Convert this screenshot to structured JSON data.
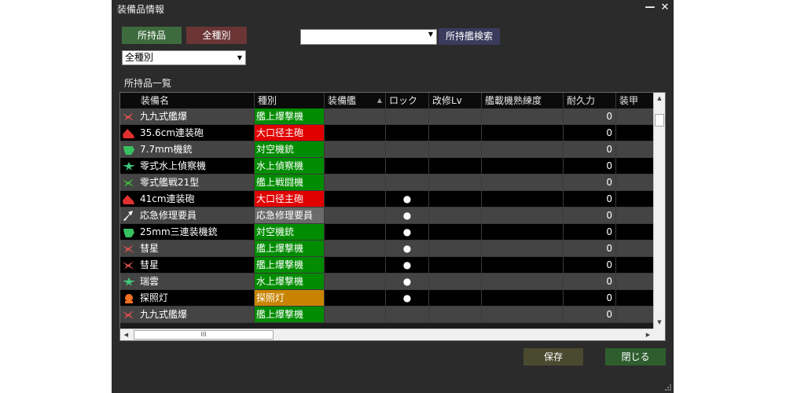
{
  "window": {
    "title": "装備品情報",
    "minimize_glyph": "—",
    "close_glyph": "✕"
  },
  "toolbar": {
    "owned_label": "所持品",
    "all_types_label": "全種別",
    "type_filter_value": "全種別",
    "ship_search_value": "",
    "ship_search_button": "所持艦検索"
  },
  "list_label": "所持品一覧",
  "columns": [
    "装備名",
    "種別",
    "装備艦",
    "ロック",
    "改修Lv",
    "艦載機熟練度",
    "耐久力",
    "装甲"
  ],
  "rows": [
    {
      "name": "九九式艦爆",
      "type": "艦上爆撃機",
      "type_color": "#008c00",
      "icon": "dive-bomber-icon",
      "icon_color": "#e05050",
      "locked": "",
      "durability": "0"
    },
    {
      "name": "35.6cm連装砲",
      "type": "大口径主砲",
      "type_color": "#e00000",
      "icon": "large-gun-icon",
      "icon_color": "#e03030",
      "locked": "",
      "durability": "0"
    },
    {
      "name": "7.7mm機銃",
      "type": "対空機銃",
      "type_color": "#008c00",
      "icon": "aa-gun-icon",
      "icon_color": "#38c060",
      "locked": "",
      "durability": "0"
    },
    {
      "name": "零式水上偵察機",
      "type": "水上偵察機",
      "type_color": "#008c00",
      "icon": "seaplane-icon",
      "icon_color": "#40c878",
      "locked": "",
      "durability": "0"
    },
    {
      "name": "零式艦戦21型",
      "type": "艦上戦闘機",
      "type_color": "#008c00",
      "icon": "fighter-icon",
      "icon_color": "#40c040",
      "locked": "",
      "durability": "0"
    },
    {
      "name": "41cm連装砲",
      "type": "大口径主砲",
      "type_color": "#e00000",
      "icon": "large-gun-icon",
      "icon_color": "#e03030",
      "locked": "●",
      "durability": "0"
    },
    {
      "name": "応急修理要員",
      "type": "応急修理要員",
      "type_color": "#6a6a6a",
      "icon": "repair-crew-icon",
      "icon_color": "#ffffff",
      "locked": "●",
      "durability": "0"
    },
    {
      "name": "25mm三連装機銃",
      "type": "対空機銃",
      "type_color": "#008c00",
      "icon": "aa-gun-icon",
      "icon_color": "#38c060",
      "locked": "●",
      "durability": "0"
    },
    {
      "name": "彗星",
      "type": "艦上爆撃機",
      "type_color": "#008c00",
      "icon": "dive-bomber-icon",
      "icon_color": "#e05050",
      "locked": "●",
      "durability": "0"
    },
    {
      "name": "彗星",
      "type": "艦上爆撃機",
      "type_color": "#008c00",
      "icon": "dive-bomber-icon",
      "icon_color": "#e05050",
      "locked": "●",
      "durability": "0"
    },
    {
      "name": "瑞雲",
      "type": "水上爆撃機",
      "type_color": "#008c00",
      "icon": "seaplane-icon",
      "icon_color": "#40c878",
      "locked": "●",
      "durability": "0"
    },
    {
      "name": "探照灯",
      "type": "探照灯",
      "type_color": "#c88400",
      "icon": "searchlight-icon",
      "icon_color": "#f07020",
      "locked": "●",
      "durability": "0"
    },
    {
      "name": "九九式艦爆",
      "type": "艦上爆撃機",
      "type_color": "#008c00",
      "icon": "dive-bomber-icon",
      "icon_color": "#e05050",
      "locked": "",
      "durability": "0"
    }
  ],
  "hscroll_glyph": "III",
  "footer": {
    "save_label": "保存",
    "close_label": "閉じる"
  },
  "colors": {
    "owned_btn": "#3e6b3e",
    "all_types_btn": "#6b3535",
    "search_btn": "#3b3b5e",
    "save_btn": "#4a4a30",
    "close_btn": "#2e5e2e",
    "row_even": "#444444",
    "row_odd": "#000000"
  }
}
